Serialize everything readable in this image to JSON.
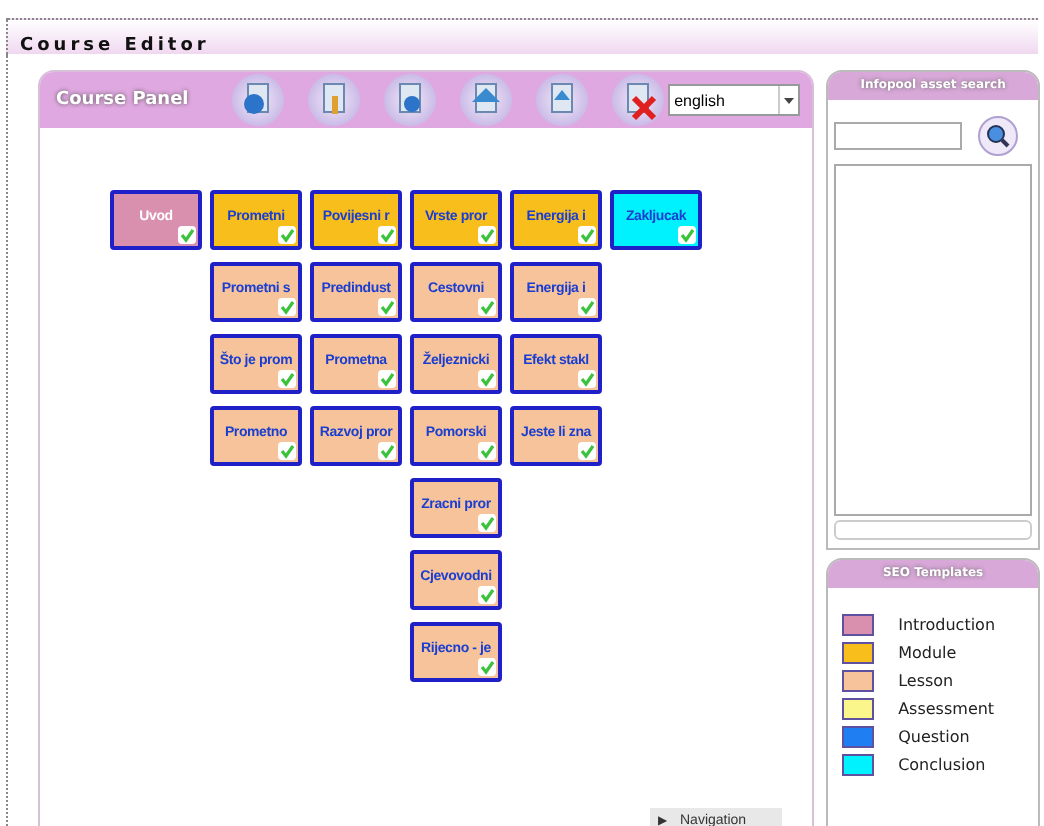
{
  "window": {
    "title": "Course Editor"
  },
  "course_panel": {
    "title": "Course Panel",
    "language": "english",
    "toolbar": [
      {
        "kind": "globe"
      },
      {
        "kind": "info"
      },
      {
        "kind": "person"
      },
      {
        "kind": "up"
      },
      {
        "kind": "page"
      },
      {
        "kind": "delete"
      }
    ],
    "columns": [
      {
        "nodes": [
          {
            "kind": "intro",
            "label": "Uvod",
            "done": true
          }
        ]
      },
      {
        "nodes": [
          {
            "kind": "module",
            "label": "Prometni",
            "done": true
          },
          {
            "kind": "lesson",
            "label": "Prometni s",
            "done": true
          },
          {
            "kind": "lesson",
            "label": "Što je prom",
            "done": true
          },
          {
            "kind": "lesson",
            "label": "Prometno",
            "done": true
          }
        ]
      },
      {
        "nodes": [
          {
            "kind": "module",
            "label": "Povijesni r",
            "done": true
          },
          {
            "kind": "lesson",
            "label": "Predindust",
            "done": true
          },
          {
            "kind": "lesson",
            "label": "Prometna",
            "done": true
          },
          {
            "kind": "lesson",
            "label": "Razvoj pror",
            "done": true
          }
        ]
      },
      {
        "nodes": [
          {
            "kind": "module",
            "label": "Vrste pror",
            "done": true
          },
          {
            "kind": "lesson",
            "label": "Cestovni",
            "done": true
          },
          {
            "kind": "lesson",
            "label": "Željeznicki",
            "done": true
          },
          {
            "kind": "lesson",
            "label": "Pomorski",
            "done": true
          },
          {
            "kind": "lesson",
            "label": "Zracni pror",
            "done": true
          },
          {
            "kind": "lesson",
            "label": "Cjevovodni",
            "done": true
          },
          {
            "kind": "lesson",
            "label": "Rijecno - je",
            "done": true
          }
        ]
      },
      {
        "nodes": [
          {
            "kind": "module",
            "label": "Energija i",
            "done": true
          },
          {
            "kind": "lesson",
            "label": "Energija i",
            "done": true
          },
          {
            "kind": "lesson",
            "label": "Efekt stakl",
            "done": true
          },
          {
            "kind": "lesson",
            "label": "Jeste li zna",
            "done": true
          }
        ]
      },
      {
        "nodes": [
          {
            "kind": "conclusion",
            "label": "Zakljucak",
            "done": true
          }
        ]
      }
    ],
    "navigation": {
      "icon": "▶",
      "label": "Navigation"
    }
  },
  "infopool": {
    "title": "Infopool asset search"
  },
  "seo_templates": {
    "title": "SEO Templates",
    "items": [
      {
        "label": "Introduction",
        "color": "#d990ae"
      },
      {
        "label": "Module",
        "color": "#f8bf1c"
      },
      {
        "label": "Lesson",
        "color": "#f6c39a"
      },
      {
        "label": "Assessment",
        "color": "#fbf68c"
      },
      {
        "label": "Question",
        "color": "#1f7ff2"
      },
      {
        "label": "Conclusion",
        "color": "#00f2ff"
      }
    ]
  }
}
